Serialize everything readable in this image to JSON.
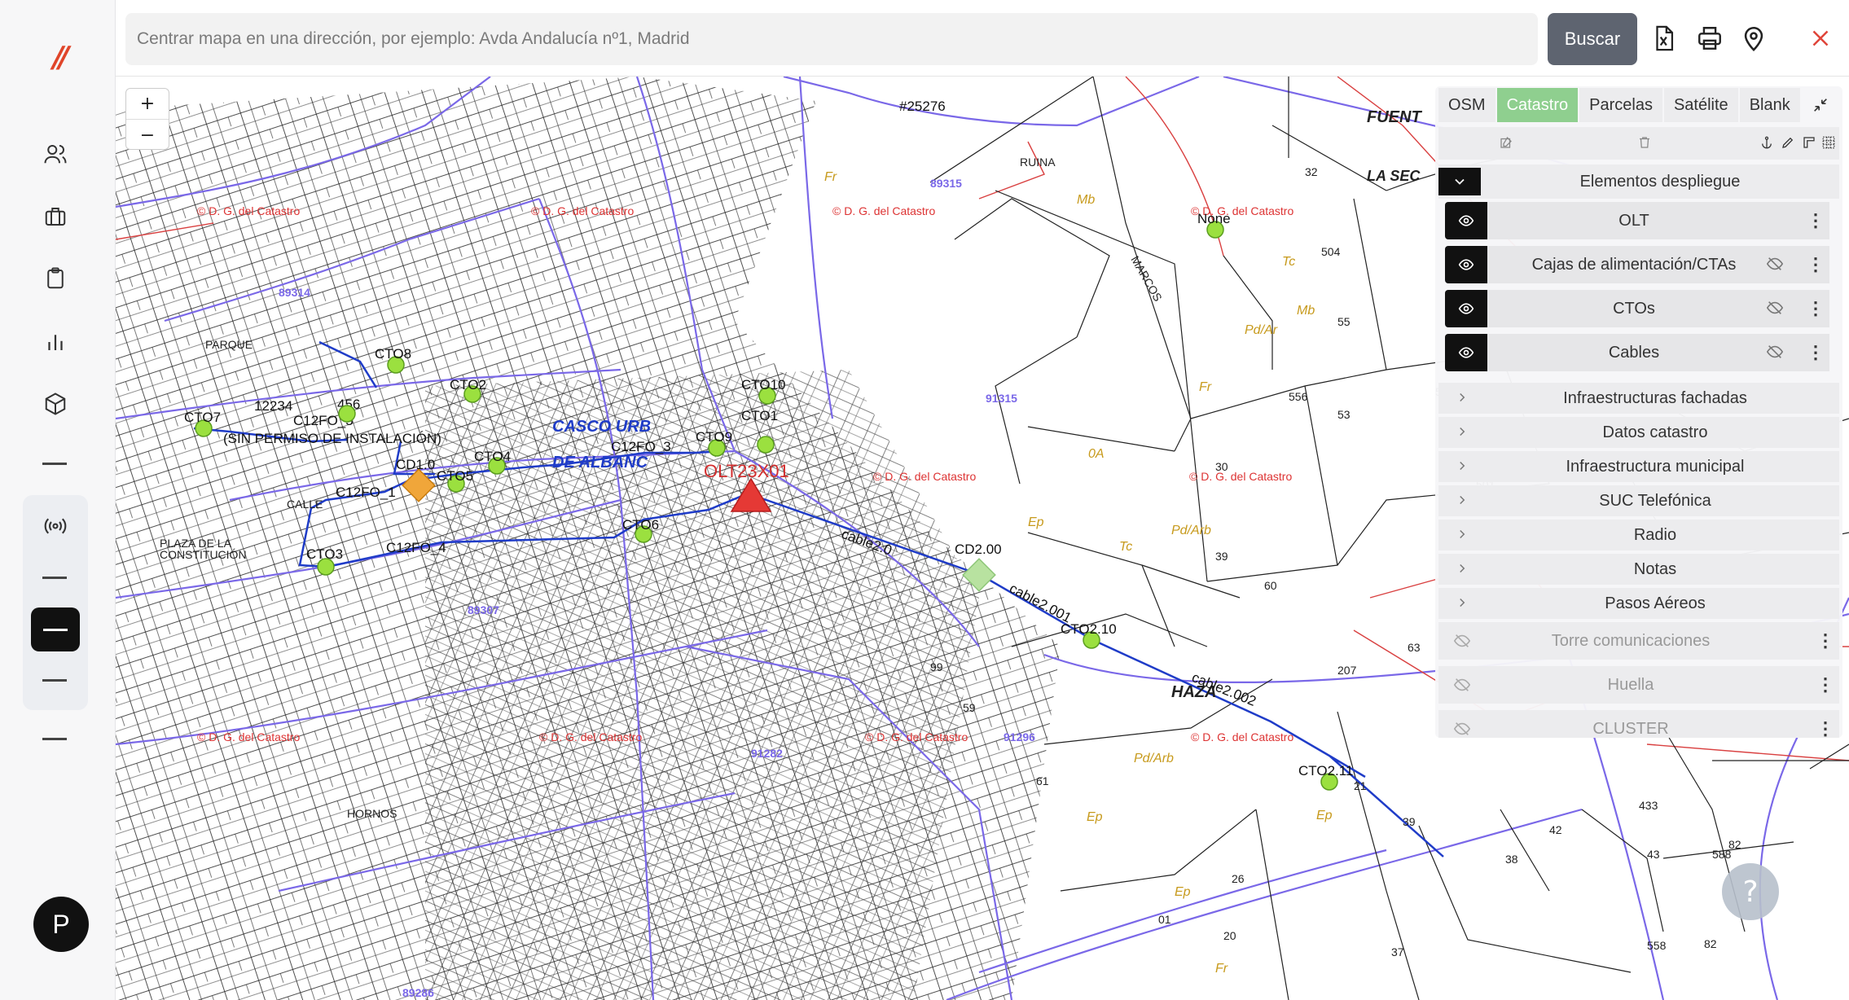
{
  "sidebar": {
    "logo": "//",
    "icons": [
      "users-icon",
      "briefcase-icon",
      "clipboard-icon",
      "bar-chart-icon",
      "box-icon",
      "broadcast-icon"
    ],
    "avatar_initial": "P"
  },
  "topbar": {
    "search_placeholder": "Centrar mapa en una dirección, por ejemplo: Avda Andalucía nº1, Madrid",
    "search_button": "Buscar",
    "icons": [
      "excel-export-icon",
      "print-icon",
      "location-pin-icon",
      "close-icon"
    ]
  },
  "map": {
    "zoom_in": "+",
    "zoom_out": "−",
    "help": "?",
    "network_labels": {
      "olt": "OLT23X01",
      "cd1": "CD1.0",
      "cd2": "CD2.00",
      "none": "None",
      "ctos": [
        "CTO1",
        "CTO2",
        "CTO3",
        "CTO4",
        "CTO5",
        "CTO6",
        "CTO7",
        "CTO8",
        "CTO9",
        "CTO10",
        "CTO2.10",
        "CTO2.11"
      ],
      "cables": [
        "cable2.0",
        "cable2.001",
        "cable2.002",
        "C12FO_1",
        "C12FO_3",
        "C12FO_4",
        "C12FO_5"
      ],
      "other": [
        "12234",
        "456",
        "(SIN PERMISO DE INSTALACIÓN)",
        "#25276"
      ]
    },
    "street_labels": [
      "CASCO URB",
      "DE ALBANC",
      "HAZA",
      "FUENT",
      "LA SEC",
      "PARQUE",
      "PLAZA DE LA",
      "CONSTITUCIÓN",
      "CALLE",
      "HORNOS",
      "RUINA",
      "MARCOS"
    ],
    "cadastre_watermark": "© D. G. del Catastro",
    "parcel_numbers": [
      "91296",
      "89314",
      "89315",
      "89307",
      "89286",
      "91315",
      "91282"
    ]
  },
  "layer_panel": {
    "basemap_tabs": [
      "OSM",
      "Catastro",
      "Parcelas",
      "Satélite",
      "Blank"
    ],
    "active_tab": "Catastro",
    "group_title": "Elementos despliegue",
    "layers": [
      "OLT",
      "Cajas de alimentación/CTAs",
      "CTOs",
      "Cables"
    ],
    "sections": [
      "Infraestructuras fachadas",
      "Datos catastro",
      "Infraestructura municipal",
      "SUC Telefónica",
      "Radio",
      "Notas",
      "Pasos Aéreos"
    ],
    "hidden_layers": [
      "Torre comunicaciones",
      "Huella",
      "CLUSTER"
    ]
  },
  "colors": {
    "accent_green": "#8fcf8f",
    "cto_fill": "#9be03f",
    "olt_red": "#e53935",
    "cd_orange": "#f0a63a",
    "cd2_green": "#b8e2a0",
    "parcel_blue": "#7a68e8",
    "cadastre_red": "#d33"
  }
}
